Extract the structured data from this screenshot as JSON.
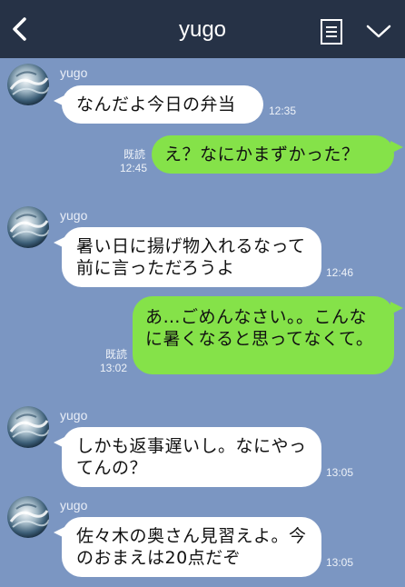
{
  "header": {
    "title": "yugo",
    "back_icon": "chevron-left-icon",
    "menu_icon": "list-icon",
    "dropdown_icon": "chevron-down-icon",
    "background": "#263246"
  },
  "colors": {
    "chat_background": "#7b96c2",
    "incoming_bubble": "#ffffff",
    "outgoing_bubble": "#85e249"
  },
  "messages": [
    {
      "sender": "yugo",
      "direction": "in",
      "text": "なんだよ今日の弁当",
      "time": "12:35"
    },
    {
      "direction": "out",
      "text": "え？なにかまずかった？",
      "read": "既読",
      "time": "12:45"
    },
    {
      "sender": "yugo",
      "direction": "in",
      "text": "暑い日に揚げ物入れるなって前に言っただろうよ",
      "time": "12:46"
    },
    {
      "direction": "out",
      "text": "あ…ごめんなさい。。こんなに暑くなると思ってなくて。",
      "read": "既読",
      "time": "13:02"
    },
    {
      "sender": "yugo",
      "direction": "in",
      "text": "しかも返事遅いし。なにやってんの？",
      "time": "13:05"
    },
    {
      "sender": "yugo",
      "direction": "in",
      "text": "佐々木の奥さん見習えよ。今のおまえは20点だぞ",
      "time": "13:05"
    }
  ]
}
